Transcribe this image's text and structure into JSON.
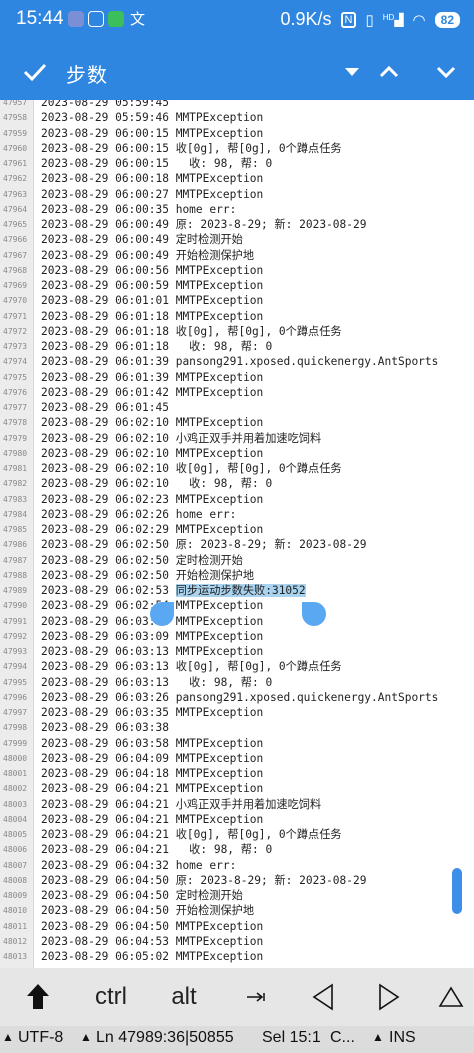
{
  "status_bar": {
    "time": "15:44",
    "net_speed": "0.9K/s",
    "signal_label": "HD",
    "battery": "82"
  },
  "toolbar": {
    "title": "步数"
  },
  "editor": {
    "lines": [
      {
        "n": "47957",
        "t": "2023-08-29 05:59:45"
      },
      {
        "n": "47958",
        "t": "2023-08-29 05:59:46 MMTPException"
      },
      {
        "n": "47959",
        "t": "2023-08-29 06:00:15 MMTPException"
      },
      {
        "n": "47960",
        "t": "2023-08-29 06:00:15 收[0g], 帮[0g], 0个蹲点任务"
      },
      {
        "n": "47961",
        "t": "2023-08-29 06:00:15   收: 98, 帮: 0"
      },
      {
        "n": "47962",
        "t": "2023-08-29 06:00:18 MMTPException"
      },
      {
        "n": "47963",
        "t": "2023-08-29 06:00:27 MMTPException"
      },
      {
        "n": "47964",
        "t": "2023-08-29 06:00:35 home err:"
      },
      {
        "n": "47965",
        "t": "2023-08-29 06:00:49 原: 2023-8-29; 新: 2023-08-29"
      },
      {
        "n": "47966",
        "t": "2023-08-29 06:00:49 定时检测开始"
      },
      {
        "n": "47967",
        "t": "2023-08-29 06:00:49 开始检测保护地"
      },
      {
        "n": "47968",
        "t": "2023-08-29 06:00:56 MMTPException"
      },
      {
        "n": "47969",
        "t": "2023-08-29 06:00:59 MMTPException"
      },
      {
        "n": "47970",
        "t": "2023-08-29 06:01:01 MMTPException"
      },
      {
        "n": "47971",
        "t": "2023-08-29 06:01:18 MMTPException"
      },
      {
        "n": "47972",
        "t": "2023-08-29 06:01:18 收[0g], 帮[0g], 0个蹲点任务"
      },
      {
        "n": "47973",
        "t": "2023-08-29 06:01:18   收: 98, 帮: 0"
      },
      {
        "n": "47974",
        "t": "2023-08-29 06:01:39 pansong291.xposed.quickenergy.AntSports"
      },
      {
        "n": "47975",
        "t": "2023-08-29 06:01:39 MMTPException"
      },
      {
        "n": "47976",
        "t": "2023-08-29 06:01:42 MMTPException"
      },
      {
        "n": "47977",
        "t": "2023-08-29 06:01:45"
      },
      {
        "n": "47978",
        "t": "2023-08-29 06:02:10 MMTPException"
      },
      {
        "n": "47979",
        "t": "2023-08-29 06:02:10 小鸡正双手并用着加速吃饲料"
      },
      {
        "n": "47980",
        "t": "2023-08-29 06:02:10 MMTPException"
      },
      {
        "n": "47981",
        "t": "2023-08-29 06:02:10 收[0g], 帮[0g], 0个蹲点任务"
      },
      {
        "n": "47982",
        "t": "2023-08-29 06:02:10   收: 98, 帮: 0"
      },
      {
        "n": "47983",
        "t": "2023-08-29 06:02:23 MMTPException"
      },
      {
        "n": "47984",
        "t": "2023-08-29 06:02:26 home err:"
      },
      {
        "n": "47985",
        "t": "2023-08-29 06:02:29 MMTPException"
      },
      {
        "n": "47986",
        "t": "2023-08-29 06:02:50 原: 2023-8-29; 新: 2023-08-29"
      },
      {
        "n": "47987",
        "t": "2023-08-29 06:02:50 定时检测开始"
      },
      {
        "n": "47988",
        "t": "2023-08-29 06:02:50 开始检测保护地"
      },
      {
        "n": "47989",
        "t": "2023-08-29 06:02:53 ",
        "sel": "同步运动步数失败:31052"
      },
      {
        "n": "47990",
        "t": "2023-08-29 06:02:54 MMTPException"
      },
      {
        "n": "47991",
        "t": "2023-08-29 06:03:04 MMTPException"
      },
      {
        "n": "47992",
        "t": "2023-08-29 06:03:09 MMTPException"
      },
      {
        "n": "47993",
        "t": "2023-08-29 06:03:13 MMTPException"
      },
      {
        "n": "47994",
        "t": "2023-08-29 06:03:13 收[0g], 帮[0g], 0个蹲点任务"
      },
      {
        "n": "47995",
        "t": "2023-08-29 06:03:13   收: 98, 帮: 0"
      },
      {
        "n": "47996",
        "t": "2023-08-29 06:03:26 pansong291.xposed.quickenergy.AntSports"
      },
      {
        "n": "47997",
        "t": "2023-08-29 06:03:35 MMTPException"
      },
      {
        "n": "47998",
        "t": "2023-08-29 06:03:38"
      },
      {
        "n": "47999",
        "t": "2023-08-29 06:03:58 MMTPException"
      },
      {
        "n": "48000",
        "t": "2023-08-29 06:04:09 MMTPException"
      },
      {
        "n": "48001",
        "t": "2023-08-29 06:04:18 MMTPException"
      },
      {
        "n": "48002",
        "t": "2023-08-29 06:04:21 MMTPException"
      },
      {
        "n": "48003",
        "t": "2023-08-29 06:04:21 小鸡正双手并用着加速吃饲料"
      },
      {
        "n": "48004",
        "t": "2023-08-29 06:04:21 MMTPException"
      },
      {
        "n": "48005",
        "t": "2023-08-29 06:04:21 收[0g], 帮[0g], 0个蹲点任务"
      },
      {
        "n": "48006",
        "t": "2023-08-29 06:04:21   收: 98, 帮: 0"
      },
      {
        "n": "48007",
        "t": "2023-08-29 06:04:32 home err:"
      },
      {
        "n": "48008",
        "t": "2023-08-29 06:04:50 原: 2023-8-29; 新: 2023-08-29"
      },
      {
        "n": "48009",
        "t": "2023-08-29 06:04:50 定时检测开始"
      },
      {
        "n": "48010",
        "t": "2023-08-29 06:04:50 开始检测保护地"
      },
      {
        "n": "48011",
        "t": "2023-08-29 06:04:50 MMTPException"
      },
      {
        "n": "48012",
        "t": "2023-08-29 06:04:53 MMTPException"
      },
      {
        "n": "48013",
        "t": "2023-08-29 06:05:02 MMTPException"
      }
    ]
  },
  "keys": {
    "ctrl": "ctrl",
    "alt": "alt"
  },
  "bottom_bar": {
    "encoding": "UTF-8",
    "position": "Ln 47989:36|50855",
    "selection": "Sel 15:1",
    "overflow": "C...",
    "mode": "INS"
  },
  "colors": {
    "accent": "#2f86e0",
    "selection": "#a9d3ef",
    "handle": "#5ba8f2"
  }
}
